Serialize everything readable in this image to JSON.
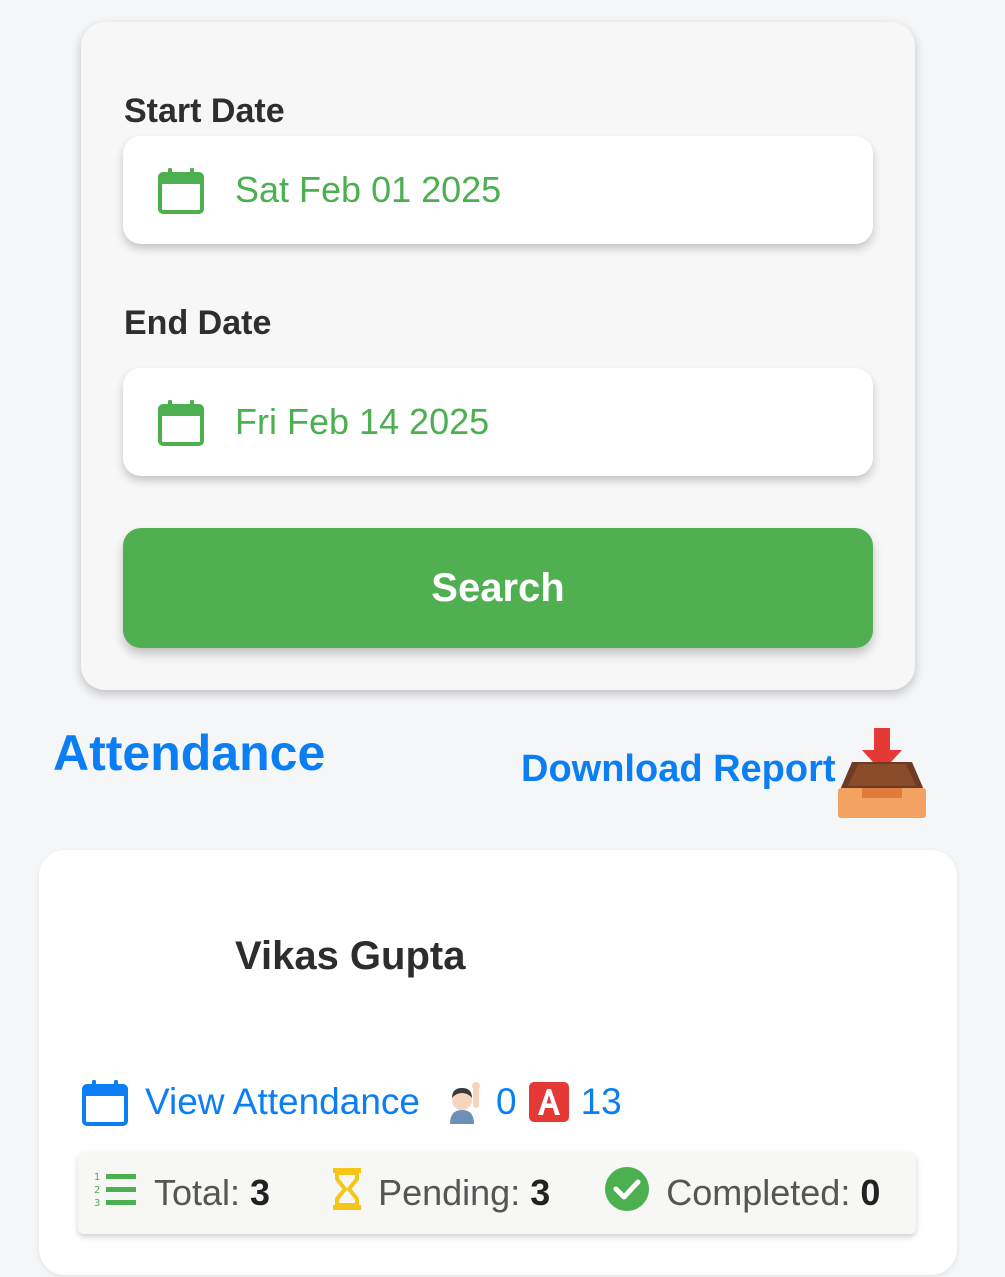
{
  "filters": {
    "start_label": "Start Date",
    "start_value": "Sat Feb 01 2025",
    "end_label": "End Date",
    "end_value": "Fri Feb 14 2025",
    "search_label": "Search"
  },
  "section": {
    "title": "Attendance",
    "download_label": "Download Report"
  },
  "employee": {
    "name": "Vikas Gupta",
    "view_label": "View Attendance",
    "present_count": "0",
    "absent_count": "13",
    "stats": {
      "total_label": "Total:",
      "total_value": "3",
      "pending_label": "Pending:",
      "pending_value": "3",
      "completed_label": "Completed:",
      "completed_value": "0"
    }
  },
  "icons": {
    "date": "calendar-icon",
    "download": "inbox-tray-icon",
    "present": "person-raising-hand-icon",
    "absent": "letter-a-badge-icon",
    "total": "numbered-list-icon",
    "pending": "hourglass-icon",
    "completed": "check-circle-icon"
  },
  "colors": {
    "accent_green": "#50af51",
    "link_blue": "#0a7ef2",
    "pending_yellow": "#f5c518",
    "badge_red": "#e53935"
  }
}
